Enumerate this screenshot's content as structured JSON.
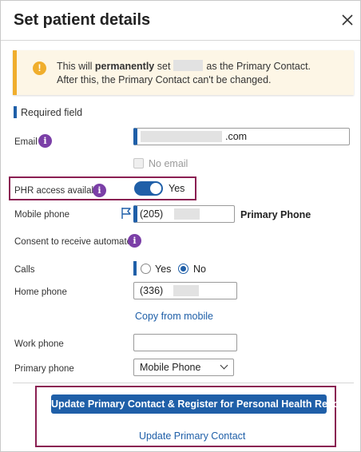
{
  "dialog": {
    "title": "Set patient details",
    "close_icon": "close-icon"
  },
  "warning": {
    "icon_glyph": "!",
    "line1_prefix": "This will ",
    "line1_bold": "permanently",
    "line1_mid": " set",
    "line1_suffix": "as the Primary Contact.",
    "line2": "After this, the Primary Contact can't be changed.",
    "accent": "#f0ae2d"
  },
  "required_legend": "Required field",
  "fields": {
    "email": {
      "label": "Email",
      "suffix": ".com"
    },
    "no_email": {
      "label": "No email",
      "checked": false
    },
    "phr": {
      "label": "PHR access available",
      "toggle_label": "Yes",
      "on": true
    },
    "mobile": {
      "label": "Mobile phone",
      "area_code": "(205)",
      "primary_label": "Primary Phone"
    },
    "consent": {
      "label": "Consent to receive automated:"
    },
    "calls": {
      "label": "Calls",
      "yes": "Yes",
      "no": "No",
      "selected": "No"
    },
    "home": {
      "label": "Home phone",
      "area_code": "(336)",
      "copy_link": "Copy from mobile"
    },
    "work": {
      "label": "Work phone",
      "value": ""
    },
    "primary_phone": {
      "label": "Primary phone",
      "selected": "Mobile Phone"
    }
  },
  "actions": {
    "primary_button": "Update Primary Contact & Register for Personal Health Record",
    "secondary_link": "Update Primary Contact"
  },
  "colors": {
    "brand": "#1f5fa8",
    "info": "#7b3fa7",
    "highlight": "#8a1f52"
  }
}
